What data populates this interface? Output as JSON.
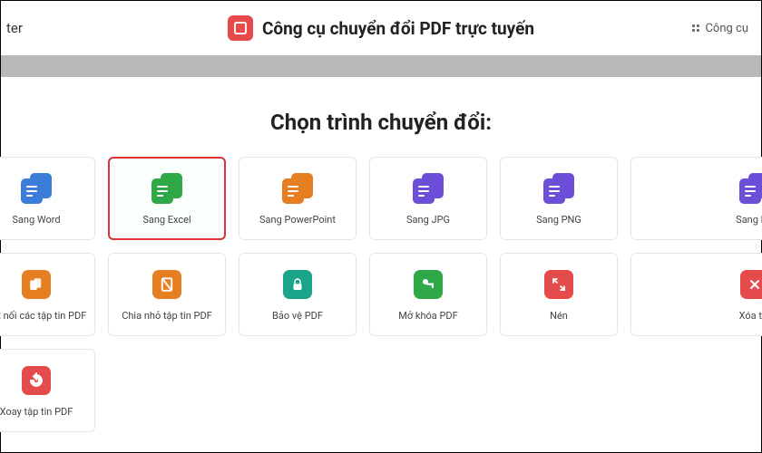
{
  "header": {
    "left_fragment": "ter",
    "title": "Công cụ chuyển đổi PDF trực tuyến",
    "tools_label": "Công cụ"
  },
  "section": {
    "title": "Chọn trình chuyển đổi:"
  },
  "tools": {
    "row1": [
      {
        "label": "Sang Word"
      },
      {
        "label": "Sang Excel"
      },
      {
        "label": "Sang PowerPoint"
      },
      {
        "label": "Sang JPG"
      },
      {
        "label": "Sang PNG"
      },
      {
        "label": "Sang PD"
      }
    ],
    "row2": [
      {
        "label": "Kết nối các tập tin PDF"
      },
      {
        "label": "Chia nhỏ tập tin PDF"
      },
      {
        "label": "Bảo vệ PDF"
      },
      {
        "label": "Mở khóa PDF"
      },
      {
        "label": "Nén"
      },
      {
        "label": "Xóa tra"
      }
    ],
    "row3": [
      {
        "label": "Xoay tập tin PDF"
      }
    ]
  },
  "selected_index": 1
}
